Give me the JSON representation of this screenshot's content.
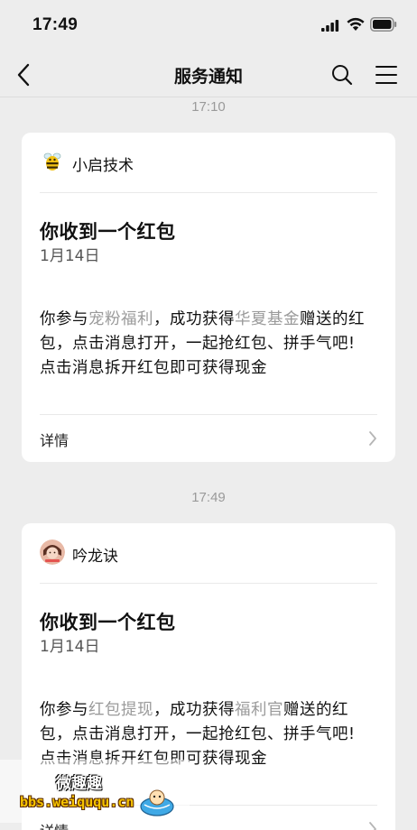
{
  "status_bar": {
    "time": "17:49"
  },
  "nav": {
    "title": "服务通知"
  },
  "messages": [
    {
      "timestamp": "17:10",
      "account": "小启技术",
      "title": "你收到一个红包",
      "date": "1月14日",
      "body": {
        "p1": "你参与",
        "hl1": "宠粉福利",
        "p2": "，成功获得",
        "hl2": "华夏基金",
        "p3": "赠送的红包，点击消息打开，一起抢红包、拼手气吧!",
        "line2": "点击消息拆开红包即可获得现金"
      },
      "detail_label": "详情"
    },
    {
      "timestamp": "17:49",
      "account": "吟龙诀",
      "title": "你收到一个红包",
      "date": "1月14日",
      "body": {
        "p1": "你参与",
        "hl1": "红包提现",
        "p2": "，成功获得",
        "hl2": "福利官",
        "p3": "赠送的红包，点击消息打开，一起抢红包、拼手气吧!",
        "line2": "点击消息拆开红包即可获得现金"
      },
      "detail_label": "详情"
    }
  ],
  "watermark": {
    "line1": "微趣趣",
    "line2": "bbs.weiququ.cn"
  },
  "colors": {
    "background": "#ededed",
    "card": "#ffffff",
    "highlight": "#9a9a9a"
  }
}
